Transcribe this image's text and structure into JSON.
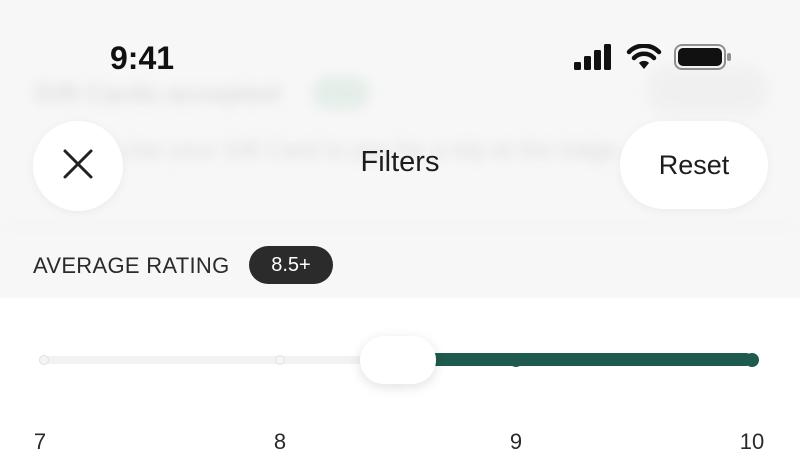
{
  "background": {
    "title": "Gift Cards accepted",
    "subtitle": "Use your Gift Card to pay for a trip at the lodge"
  },
  "status_bar": {
    "time": "9:41",
    "icons": [
      "cellular-signal-icon",
      "wifi-icon",
      "battery-icon"
    ]
  },
  "header": {
    "title": "Filters",
    "close_icon": "close-icon",
    "reset_label": "Reset"
  },
  "rating_filter": {
    "label": "AVERAGE RATING",
    "badge": "8.5+",
    "slider": {
      "min": 7,
      "max": 10,
      "selected_min": 8.5,
      "ticks": [
        "7",
        "8",
        "9",
        "10"
      ]
    }
  },
  "colors": {
    "accent": "#1f5a4e",
    "badge_bg": "#2b2b2b",
    "track": "#f2f2f2"
  }
}
